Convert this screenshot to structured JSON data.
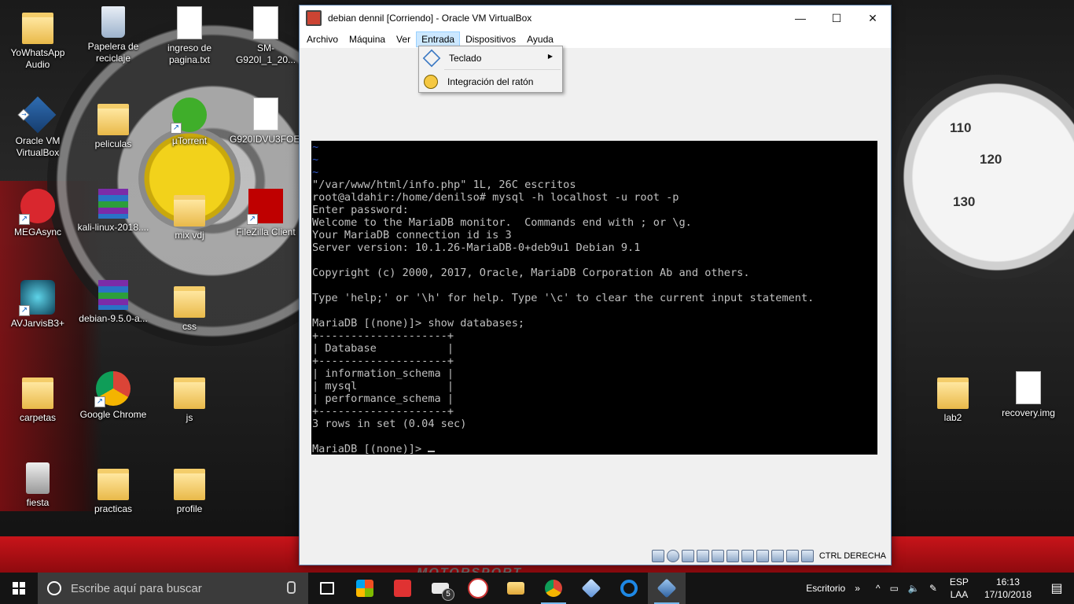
{
  "desktop": {
    "icons": [
      {
        "label": "YoWhatsApp Audio"
      },
      {
        "label": "Papelera de reciclaje"
      },
      {
        "label": "ingreso de pagina.txt"
      },
      {
        "label": "SM-G920I_1_20..."
      },
      {
        "label": "Oracle VM VirtualBox"
      },
      {
        "label": "peliculas"
      },
      {
        "label": "µTorrent"
      },
      {
        "label": "G920IDVU3FOE..."
      },
      {
        "label": "MEGAsync"
      },
      {
        "label": "kali-linux-2018...."
      },
      {
        "label": "mix vdj"
      },
      {
        "label": "FileZilla Client"
      },
      {
        "label": "AVJarvisB3+"
      },
      {
        "label": "debian-9.5.0-a..."
      },
      {
        "label": "css"
      },
      {
        "label": "carpetas"
      },
      {
        "label": "Google Chrome"
      },
      {
        "label": "js"
      },
      {
        "label": "lab2"
      },
      {
        "label": "recovery.img"
      },
      {
        "label": "fiesta"
      },
      {
        "label": "practicas"
      },
      {
        "label": "profile"
      }
    ],
    "wallpaper_text": {
      "brand": "MOTORSPORT",
      "gauge_110": "110",
      "gauge_120": "120",
      "gauge_130": "130"
    }
  },
  "window": {
    "title": "debian dennil [Corriendo] - Oracle VM VirtualBox",
    "minimize": "—",
    "maximize": "☐",
    "close": "✕",
    "menu": [
      "Archivo",
      "Máquina",
      "Ver",
      "Entrada",
      "Dispositivos",
      "Ayuda"
    ],
    "dropdown": {
      "items": [
        {
          "label": "Teclado",
          "submenu_arrow": "▶"
        },
        {
          "label": "Integración del ratón"
        }
      ]
    },
    "terminal": {
      "lines": [
        "~",
        "~",
        "~",
        "\"/var/www/html/info.php\" 1L, 26C escritos",
        "root@aldahir:/home/denilso# mysql -h localhost -u root -p",
        "Enter password:",
        "Welcome to the MariaDB monitor.  Commands end with ; or \\g.",
        "Your MariaDB connection id is 3",
        "Server version: 10.1.26-MariaDB-0+deb9u1 Debian 9.1",
        "",
        "Copyright (c) 2000, 2017, Oracle, MariaDB Corporation Ab and others.",
        "",
        "Type 'help;' or '\\h' for help. Type '\\c' to clear the current input statement.",
        "",
        "MariaDB [(none)]> show databases;",
        "+--------------------+",
        "| Database           |",
        "+--------------------+",
        "| information_schema |",
        "| mysql              |",
        "| performance_schema |",
        "+--------------------+",
        "3 rows in set (0.04 sec)",
        "",
        "MariaDB [(none)]> "
      ]
    },
    "status": {
      "host_key": "CTRL DERECHA"
    }
  },
  "taskbar": {
    "search_placeholder": "Escribe aquí para buscar",
    "mail_badge": "5",
    "tray": {
      "label": "Escritorio",
      "chevron": "»",
      "lang_top": "ESP",
      "lang_bottom": "LAA"
    },
    "clock": {
      "time": "16:13",
      "date": "17/10/2018"
    }
  }
}
